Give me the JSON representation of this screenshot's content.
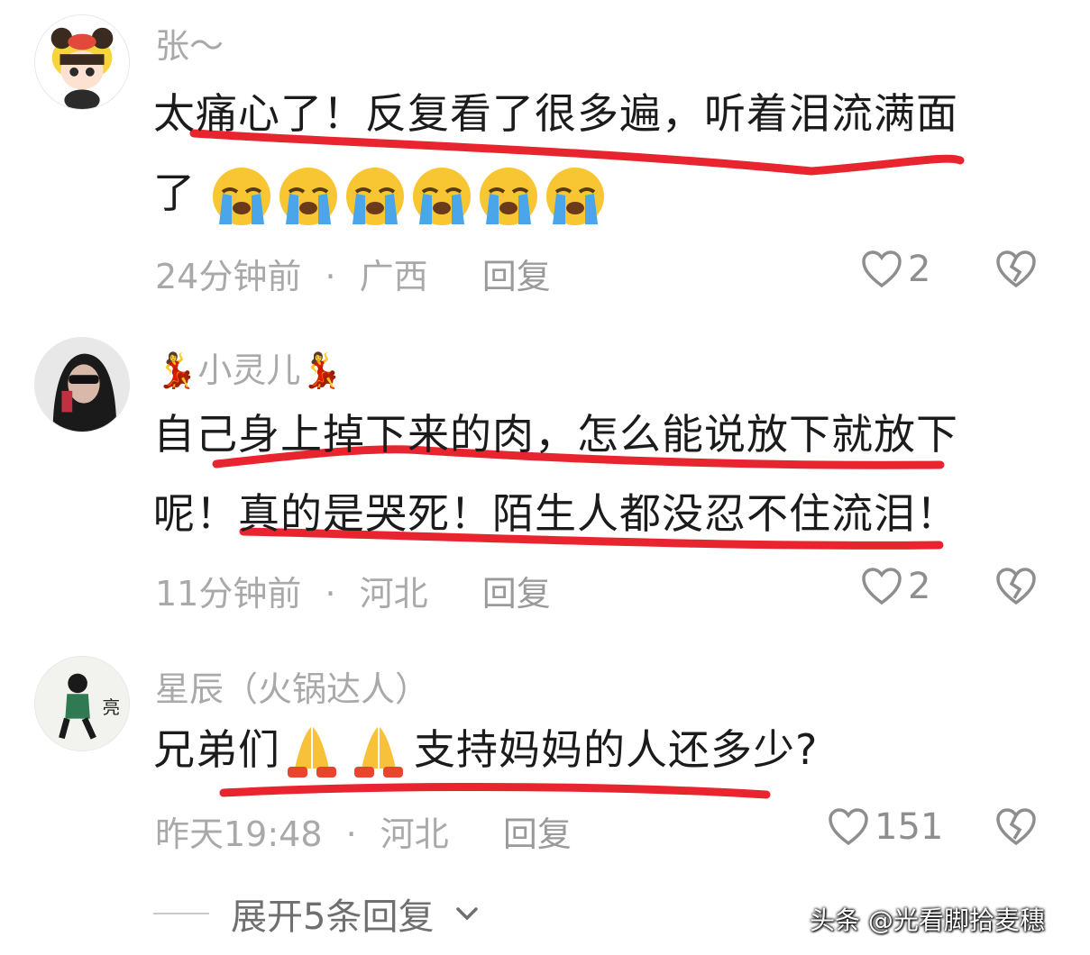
{
  "comments": [
    {
      "username": "张～",
      "text_line1": "太痛心了！反复看了很多遍，听着泪流满面",
      "text_line2": "了",
      "emojis": [
        "crying-emoji",
        "crying-emoji",
        "crying-emoji",
        "crying-emoji",
        "crying-emoji",
        "crying-emoji"
      ],
      "time": "24分钟前",
      "separator": "·",
      "location": "广西",
      "reply_label": "回复",
      "likes": "2"
    },
    {
      "username": "小灵儿",
      "username_decoration": "dancer-emoji",
      "text_line1": "自己身上掉下来的肉，怎么能说放下就放下",
      "text_line2": "呢！真的是哭死！陌生人都没忍不住流泪！",
      "time": "11分钟前",
      "separator": "·",
      "location": "河北",
      "reply_label": "回复",
      "likes": "2"
    },
    {
      "username": "星辰（火锅达人）",
      "text_part1": "兄弟们",
      "text_emojis": [
        "pray-emoji",
        "pray-emoji"
      ],
      "text_part2": "支持妈妈的人还多少?",
      "time": "昨天19:48",
      "separator": "·",
      "location": "河北",
      "reply_label": "回复",
      "likes": "151",
      "avatar_label": "亮"
    }
  ],
  "expand_label": "展开5条回复",
  "watermark": "头条 @光看脚拾麦穗",
  "accent_underline_color": "#e8252f"
}
